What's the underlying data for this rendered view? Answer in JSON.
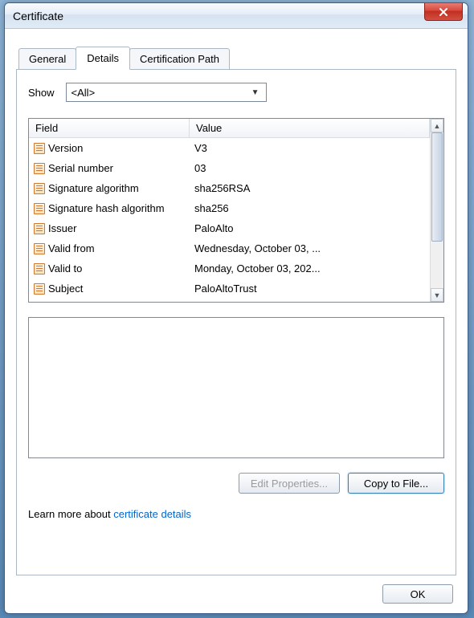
{
  "window": {
    "title": "Certificate"
  },
  "tabs": {
    "general": "General",
    "details": "Details",
    "cert_path": "Certification Path"
  },
  "show": {
    "label": "Show",
    "value": "<All>"
  },
  "columns": {
    "field": "Field",
    "value": "Value"
  },
  "rows": [
    {
      "field": "Version",
      "value": "V3"
    },
    {
      "field": "Serial number",
      "value": "03"
    },
    {
      "field": "Signature algorithm",
      "value": "sha256RSA"
    },
    {
      "field": "Signature hash algorithm",
      "value": "sha256"
    },
    {
      "field": "Issuer",
      "value": "PaloAlto"
    },
    {
      "field": "Valid from",
      "value": "Wednesday, October 03, ..."
    },
    {
      "field": "Valid to",
      "value": "Monday, October 03, 202..."
    },
    {
      "field": "Subject",
      "value": "PaloAltoTrust"
    }
  ],
  "buttons": {
    "edit_props": "Edit Properties...",
    "copy_file": "Copy to File...",
    "ok": "OK"
  },
  "learn_more": {
    "prefix": "Learn more about ",
    "link": "certificate details"
  }
}
